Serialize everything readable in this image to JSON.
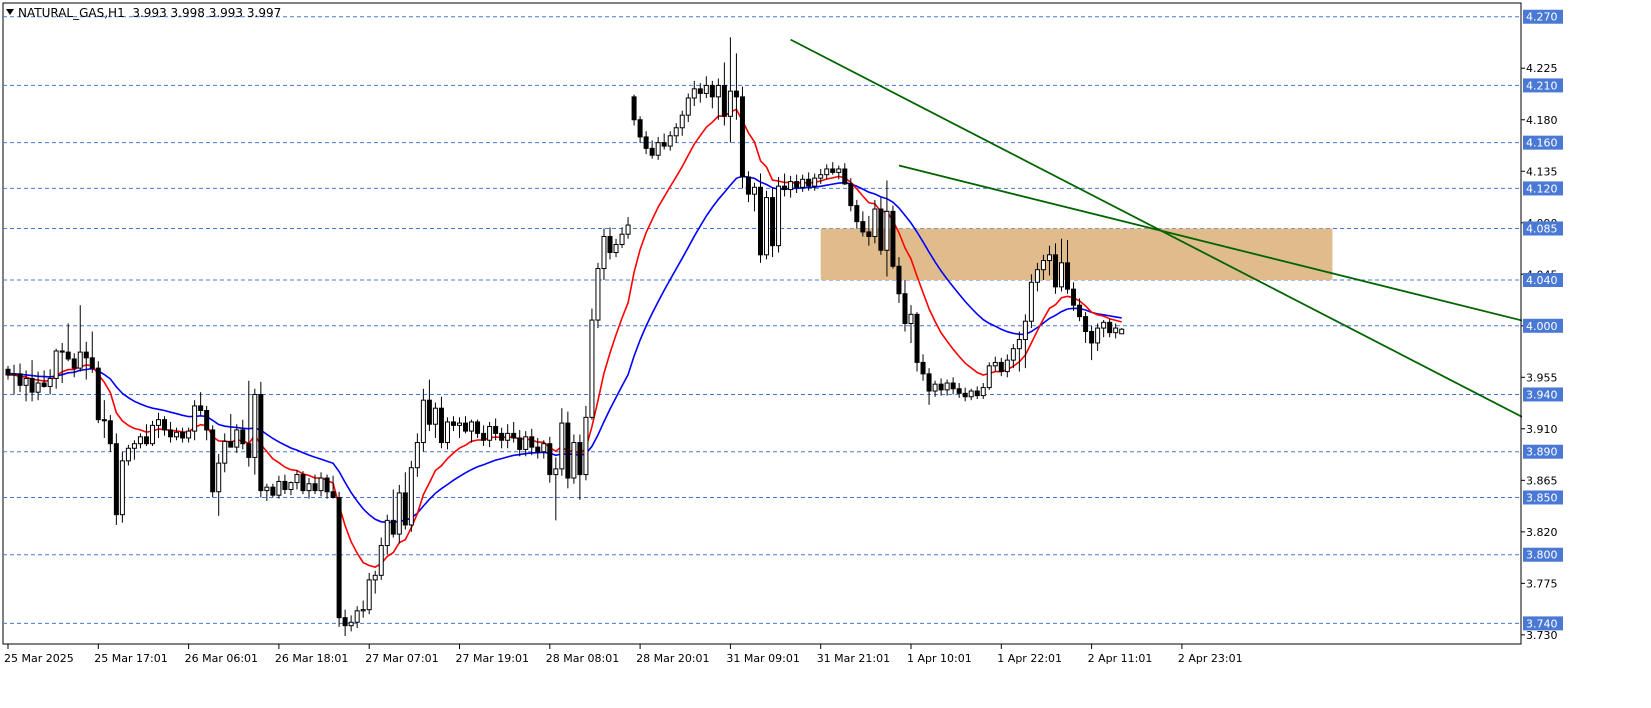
{
  "window": {
    "symbol": "NATURAL_GAS,H1",
    "ohlc": "3.993 3.998 3.993 3.997"
  },
  "chart_data": {
    "type": "candlestick",
    "ylim": [
      3.722,
      4.282
    ],
    "y_ticks": [
      "4.225",
      "4.180",
      "4.135",
      "4.090",
      "4.045",
      "4.000",
      "3.955",
      "3.910",
      "3.865",
      "3.820",
      "3.775",
      "3.730"
    ],
    "level_lines": [
      {
        "value": 4.27,
        "label": "4.270"
      },
      {
        "value": 4.21,
        "label": "4.210"
      },
      {
        "value": 4.16,
        "label": "4.160"
      },
      {
        "value": 4.12,
        "label": "4.120"
      },
      {
        "value": 4.085,
        "label": "4.085"
      },
      {
        "value": 4.04,
        "label": "4.040"
      },
      {
        "value": 4.0,
        "label": "4.000"
      },
      {
        "value": 3.94,
        "label": "3.940"
      },
      {
        "value": 3.89,
        "label": "3.890"
      },
      {
        "value": 3.85,
        "label": "3.850"
      },
      {
        "value": 3.8,
        "label": "3.800"
      },
      {
        "value": 3.74,
        "label": "3.740"
      }
    ],
    "x_labels": [
      "25 Mar 2025",
      "25 Mar 17:01",
      "26 Mar 06:01",
      "26 Mar 18:01",
      "27 Mar 07:01",
      "27 Mar 19:01",
      "28 Mar 08:01",
      "28 Mar 20:01",
      "31 Mar 09:01",
      "31 Mar 21:01",
      "1 Apr 10:01",
      "1 Apr 22:01",
      "2 Apr 11:01",
      "2 Apr 23:01"
    ],
    "resistance_zone": {
      "from_bar": 135,
      "to_bar": 220,
      "low": 4.04,
      "high": 4.085
    },
    "trendlines": [
      {
        "x1": 130.0,
        "y1": 4.25,
        "x2": 253.5,
        "y2": 3.915
      },
      {
        "x1": 148.0,
        "y1": 4.14,
        "x2": 253.5,
        "y2": 4.002
      }
    ],
    "candles": [
      {
        "o": 3.962,
        "h": 3.965,
        "l": 3.953,
        "c": 3.957
      },
      {
        "o": 3.957,
        "h": 3.966,
        "l": 3.94,
        "c": 3.958
      },
      {
        "o": 3.958,
        "h": 3.967,
        "l": 3.942,
        "c": 3.948
      },
      {
        "o": 3.948,
        "h": 3.961,
        "l": 3.934,
        "c": 3.954
      },
      {
        "o": 3.954,
        "h": 3.97,
        "l": 3.934,
        "c": 3.942
      },
      {
        "o": 3.942,
        "h": 3.96,
        "l": 3.935,
        "c": 3.95
      },
      {
        "o": 3.95,
        "h": 3.961,
        "l": 3.946,
        "c": 3.947
      },
      {
        "o": 3.947,
        "h": 3.962,
        "l": 3.94,
        "c": 3.954
      },
      {
        "o": 3.954,
        "h": 3.98,
        "l": 3.945,
        "c": 3.978
      },
      {
        "o": 3.978,
        "h": 3.985,
        "l": 3.95,
        "c": 3.977
      },
      {
        "o": 3.977,
        "h": 4.002,
        "l": 3.969,
        "c": 3.971
      },
      {
        "o": 3.971,
        "h": 3.976,
        "l": 3.955,
        "c": 3.963
      },
      {
        "o": 3.963,
        "h": 4.018,
        "l": 3.96,
        "c": 3.977
      },
      {
        "o": 3.977,
        "h": 3.986,
        "l": 3.953,
        "c": 3.972
      },
      {
        "o": 3.972,
        "h": 3.995,
        "l": 3.959,
        "c": 3.963
      },
      {
        "o": 3.963,
        "h": 3.969,
        "l": 3.915,
        "c": 3.918
      },
      {
        "o": 3.918,
        "h": 3.935,
        "l": 3.902,
        "c": 3.917
      },
      {
        "o": 3.917,
        "h": 3.922,
        "l": 3.89,
        "c": 3.897
      },
      {
        "o": 3.897,
        "h": 3.906,
        "l": 3.826,
        "c": 3.835
      },
      {
        "o": 3.835,
        "h": 3.89,
        "l": 3.828,
        "c": 3.882
      },
      {
        "o": 3.882,
        "h": 3.896,
        "l": 3.878,
        "c": 3.893
      },
      {
        "o": 3.893,
        "h": 3.9,
        "l": 3.883,
        "c": 3.897
      },
      {
        "o": 3.897,
        "h": 3.906,
        "l": 3.893,
        "c": 3.903
      },
      {
        "o": 3.903,
        "h": 3.914,
        "l": 3.895,
        "c": 3.897
      },
      {
        "o": 3.897,
        "h": 3.917,
        "l": 3.895,
        "c": 3.913
      },
      {
        "o": 3.913,
        "h": 3.924,
        "l": 3.902,
        "c": 3.918
      },
      {
        "o": 3.918,
        "h": 3.921,
        "l": 3.904,
        "c": 3.909
      },
      {
        "o": 3.909,
        "h": 3.916,
        "l": 3.898,
        "c": 3.903
      },
      {
        "o": 3.903,
        "h": 3.911,
        "l": 3.9,
        "c": 3.907
      },
      {
        "o": 3.907,
        "h": 3.911,
        "l": 3.898,
        "c": 3.902
      },
      {
        "o": 3.902,
        "h": 3.911,
        "l": 3.898,
        "c": 3.908
      },
      {
        "o": 3.908,
        "h": 3.935,
        "l": 3.9,
        "c": 3.93
      },
      {
        "o": 3.93,
        "h": 3.942,
        "l": 3.922,
        "c": 3.926
      },
      {
        "o": 3.926,
        "h": 3.93,
        "l": 3.9,
        "c": 3.909
      },
      {
        "o": 3.909,
        "h": 3.913,
        "l": 3.85,
        "c": 3.855
      },
      {
        "o": 3.855,
        "h": 3.888,
        "l": 3.834,
        "c": 3.88
      },
      {
        "o": 3.88,
        "h": 3.906,
        "l": 3.872,
        "c": 3.899
      },
      {
        "o": 3.899,
        "h": 3.923,
        "l": 3.895,
        "c": 3.894
      },
      {
        "o": 3.894,
        "h": 3.914,
        "l": 3.889,
        "c": 3.909
      },
      {
        "o": 3.909,
        "h": 3.918,
        "l": 3.892,
        "c": 3.897
      },
      {
        "o": 3.897,
        "h": 3.952,
        "l": 3.877,
        "c": 3.885
      },
      {
        "o": 3.885,
        "h": 3.945,
        "l": 3.87,
        "c": 3.94
      },
      {
        "o": 3.94,
        "h": 3.951,
        "l": 3.85,
        "c": 3.856
      },
      {
        "o": 3.856,
        "h": 3.862,
        "l": 3.847,
        "c": 3.859
      },
      {
        "o": 3.859,
        "h": 3.862,
        "l": 3.85,
        "c": 3.852
      },
      {
        "o": 3.852,
        "h": 3.869,
        "l": 3.849,
        "c": 3.864
      },
      {
        "o": 3.864,
        "h": 3.87,
        "l": 3.853,
        "c": 3.857
      },
      {
        "o": 3.857,
        "h": 3.864,
        "l": 3.852,
        "c": 3.863
      },
      {
        "o": 3.863,
        "h": 3.874,
        "l": 3.857,
        "c": 3.87
      },
      {
        "o": 3.87,
        "h": 3.873,
        "l": 3.853,
        "c": 3.856
      },
      {
        "o": 3.856,
        "h": 3.867,
        "l": 3.849,
        "c": 3.862
      },
      {
        "o": 3.862,
        "h": 3.87,
        "l": 3.853,
        "c": 3.856
      },
      {
        "o": 3.856,
        "h": 3.872,
        "l": 3.851,
        "c": 3.867
      },
      {
        "o": 3.867,
        "h": 3.87,
        "l": 3.849,
        "c": 3.855
      },
      {
        "o": 3.855,
        "h": 3.869,
        "l": 3.849,
        "c": 3.85
      },
      {
        "o": 3.85,
        "h": 3.855,
        "l": 3.737,
        "c": 3.745
      },
      {
        "o": 3.745,
        "h": 3.752,
        "l": 3.729,
        "c": 3.738
      },
      {
        "o": 3.738,
        "h": 3.747,
        "l": 3.733,
        "c": 3.741
      },
      {
        "o": 3.741,
        "h": 3.755,
        "l": 3.736,
        "c": 3.751
      },
      {
        "o": 3.751,
        "h": 3.76,
        "l": 3.745,
        "c": 3.752
      },
      {
        "o": 3.752,
        "h": 3.784,
        "l": 3.748,
        "c": 3.778
      },
      {
        "o": 3.778,
        "h": 3.786,
        "l": 3.766,
        "c": 3.782
      },
      {
        "o": 3.782,
        "h": 3.815,
        "l": 3.778,
        "c": 3.808
      },
      {
        "o": 3.808,
        "h": 3.835,
        "l": 3.8,
        "c": 3.83
      },
      {
        "o": 3.83,
        "h": 3.857,
        "l": 3.815,
        "c": 3.818
      },
      {
        "o": 3.818,
        "h": 3.861,
        "l": 3.81,
        "c": 3.854
      },
      {
        "o": 3.854,
        "h": 3.872,
        "l": 3.822,
        "c": 3.826
      },
      {
        "o": 3.826,
        "h": 3.882,
        "l": 3.82,
        "c": 3.876
      },
      {
        "o": 3.876,
        "h": 3.906,
        "l": 3.868,
        "c": 3.898
      },
      {
        "o": 3.898,
        "h": 3.945,
        "l": 3.89,
        "c": 3.935
      },
      {
        "o": 3.935,
        "h": 3.953,
        "l": 3.908,
        "c": 3.914
      },
      {
        "o": 3.914,
        "h": 3.933,
        "l": 3.902,
        "c": 3.928
      },
      {
        "o": 3.928,
        "h": 3.938,
        "l": 3.893,
        "c": 3.898
      },
      {
        "o": 3.898,
        "h": 3.92,
        "l": 3.892,
        "c": 3.916
      },
      {
        "o": 3.916,
        "h": 3.921,
        "l": 3.908,
        "c": 3.913
      },
      {
        "o": 3.913,
        "h": 3.92,
        "l": 3.902,
        "c": 3.915
      },
      {
        "o": 3.915,
        "h": 3.921,
        "l": 3.906,
        "c": 3.908
      },
      {
        "o": 3.908,
        "h": 3.918,
        "l": 3.898,
        "c": 3.916
      },
      {
        "o": 3.916,
        "h": 3.918,
        "l": 3.902,
        "c": 3.906
      },
      {
        "o": 3.906,
        "h": 3.913,
        "l": 3.895,
        "c": 3.9
      },
      {
        "o": 3.9,
        "h": 3.916,
        "l": 3.894,
        "c": 3.912
      },
      {
        "o": 3.912,
        "h": 3.919,
        "l": 3.9,
        "c": 3.906
      },
      {
        "o": 3.906,
        "h": 3.911,
        "l": 3.893,
        "c": 3.9
      },
      {
        "o": 3.9,
        "h": 3.914,
        "l": 3.893,
        "c": 3.906
      },
      {
        "o": 3.906,
        "h": 3.916,
        "l": 3.898,
        "c": 3.902
      },
      {
        "o": 3.902,
        "h": 3.909,
        "l": 3.886,
        "c": 3.892
      },
      {
        "o": 3.892,
        "h": 3.908,
        "l": 3.886,
        "c": 3.903
      },
      {
        "o": 3.903,
        "h": 3.91,
        "l": 3.887,
        "c": 3.894
      },
      {
        "o": 3.894,
        "h": 3.902,
        "l": 3.884,
        "c": 3.89
      },
      {
        "o": 3.89,
        "h": 3.9,
        "l": 3.884,
        "c": 3.897
      },
      {
        "o": 3.897,
        "h": 3.903,
        "l": 3.863,
        "c": 3.87
      },
      {
        "o": 3.87,
        "h": 3.885,
        "l": 3.83,
        "c": 3.875
      },
      {
        "o": 3.875,
        "h": 3.928,
        "l": 3.869,
        "c": 3.915
      },
      {
        "o": 3.915,
        "h": 3.925,
        "l": 3.858,
        "c": 3.867
      },
      {
        "o": 3.867,
        "h": 3.905,
        "l": 3.862,
        "c": 3.898
      },
      {
        "o": 3.898,
        "h": 3.905,
        "l": 3.848,
        "c": 3.87
      },
      {
        "o": 3.87,
        "h": 3.93,
        "l": 3.865,
        "c": 3.92
      },
      {
        "o": 3.92,
        "h": 4.015,
        "l": 3.918,
        "c": 4.005
      },
      {
        "o": 4.005,
        "h": 4.055,
        "l": 3.998,
        "c": 4.05
      },
      {
        "o": 4.05,
        "h": 4.085,
        "l": 4.04,
        "c": 4.078
      },
      {
        "o": 4.078,
        "h": 4.086,
        "l": 4.058,
        "c": 4.064
      },
      {
        "o": 4.064,
        "h": 4.076,
        "l": 4.06,
        "c": 4.071
      },
      {
        "o": 4.071,
        "h": 4.086,
        "l": 4.068,
        "c": 4.08
      },
      {
        "o": 4.08,
        "h": 4.095,
        "l": 4.076,
        "c": 4.088
      },
      {
        "o": 4.2,
        "h": 4.202,
        "l": 4.175,
        "c": 4.18
      },
      {
        "o": 4.18,
        "h": 4.183,
        "l": 4.16,
        "c": 4.165
      },
      {
        "o": 4.165,
        "h": 4.17,
        "l": 4.15,
        "c": 4.155
      },
      {
        "o": 4.155,
        "h": 4.162,
        "l": 4.146,
        "c": 4.149
      },
      {
        "o": 4.149,
        "h": 4.165,
        "l": 4.145,
        "c": 4.16
      },
      {
        "o": 4.16,
        "h": 4.168,
        "l": 4.154,
        "c": 4.157
      },
      {
        "o": 4.157,
        "h": 4.17,
        "l": 4.153,
        "c": 4.166
      },
      {
        "o": 4.166,
        "h": 4.177,
        "l": 4.16,
        "c": 4.173
      },
      {
        "o": 4.173,
        "h": 4.188,
        "l": 4.166,
        "c": 4.184
      },
      {
        "o": 4.184,
        "h": 4.203,
        "l": 4.178,
        "c": 4.199
      },
      {
        "o": 4.199,
        "h": 4.214,
        "l": 4.192,
        "c": 4.207
      },
      {
        "o": 4.207,
        "h": 4.212,
        "l": 4.195,
        "c": 4.203
      },
      {
        "o": 4.203,
        "h": 4.218,
        "l": 4.199,
        "c": 4.21
      },
      {
        "o": 4.21,
        "h": 4.214,
        "l": 4.19,
        "c": 4.2
      },
      {
        "o": 4.2,
        "h": 4.216,
        "l": 4.18,
        "c": 4.21
      },
      {
        "o": 4.21,
        "h": 4.23,
        "l": 4.175,
        "c": 4.183
      },
      {
        "o": 4.183,
        "h": 4.252,
        "l": 4.16,
        "c": 4.205
      },
      {
        "o": 4.205,
        "h": 4.238,
        "l": 4.18,
        "c": 4.2
      },
      {
        "o": 4.2,
        "h": 4.209,
        "l": 4.12,
        "c": 4.13
      },
      {
        "o": 4.13,
        "h": 4.135,
        "l": 4.108,
        "c": 4.115
      },
      {
        "o": 4.115,
        "h": 4.125,
        "l": 4.1,
        "c": 4.121
      },
      {
        "o": 4.121,
        "h": 4.133,
        "l": 4.055,
        "c": 4.062
      },
      {
        "o": 4.062,
        "h": 4.118,
        "l": 4.058,
        "c": 4.112
      },
      {
        "o": 4.112,
        "h": 4.12,
        "l": 4.06,
        "c": 4.07
      },
      {
        "o": 4.07,
        "h": 4.13,
        "l": 4.064,
        "c": 4.122
      },
      {
        "o": 4.122,
        "h": 4.133,
        "l": 4.113,
        "c": 4.119
      },
      {
        "o": 4.119,
        "h": 4.131,
        "l": 4.112,
        "c": 4.126
      },
      {
        "o": 4.126,
        "h": 4.132,
        "l": 4.116,
        "c": 4.121
      },
      {
        "o": 4.121,
        "h": 4.132,
        "l": 4.117,
        "c": 4.128
      },
      {
        "o": 4.128,
        "h": 4.134,
        "l": 4.118,
        "c": 4.122
      },
      {
        "o": 4.122,
        "h": 4.133,
        "l": 4.118,
        "c": 4.129
      },
      {
        "o": 4.129,
        "h": 4.137,
        "l": 4.124,
        "c": 4.132
      },
      {
        "o": 4.132,
        "h": 4.141,
        "l": 4.128,
        "c": 4.137
      },
      {
        "o": 4.137,
        "h": 4.143,
        "l": 4.132,
        "c": 4.134
      },
      {
        "o": 4.134,
        "h": 4.14,
        "l": 4.128,
        "c": 4.137
      },
      {
        "o": 4.137,
        "h": 4.142,
        "l": 4.123,
        "c": 4.124
      },
      {
        "o": 4.124,
        "h": 4.129,
        "l": 4.1,
        "c": 4.105
      },
      {
        "o": 4.105,
        "h": 4.11,
        "l": 4.085,
        "c": 4.091
      },
      {
        "o": 4.091,
        "h": 4.1,
        "l": 4.078,
        "c": 4.082
      },
      {
        "o": 4.082,
        "h": 4.096,
        "l": 4.07,
        "c": 4.078
      },
      {
        "o": 4.078,
        "h": 4.11,
        "l": 4.072,
        "c": 4.102
      },
      {
        "o": 4.102,
        "h": 4.112,
        "l": 4.062,
        "c": 4.066
      },
      {
        "o": 4.066,
        "h": 4.127,
        "l": 4.043,
        "c": 4.1
      },
      {
        "o": 4.1,
        "h": 4.105,
        "l": 4.05,
        "c": 4.052
      },
      {
        "o": 4.052,
        "h": 4.06,
        "l": 4.02,
        "c": 4.028
      },
      {
        "o": 4.028,
        "h": 4.04,
        "l": 3.995,
        "c": 4.002
      },
      {
        "o": 4.002,
        "h": 4.018,
        "l": 3.985,
        "c": 4.01
      },
      {
        "o": 4.01,
        "h": 4.012,
        "l": 3.96,
        "c": 3.968
      },
      {
        "o": 3.968,
        "h": 3.975,
        "l": 3.952,
        "c": 3.958
      },
      {
        "o": 3.958,
        "h": 3.963,
        "l": 3.931,
        "c": 3.943
      },
      {
        "o": 3.943,
        "h": 3.952,
        "l": 3.938,
        "c": 3.949
      },
      {
        "o": 3.949,
        "h": 3.954,
        "l": 3.939,
        "c": 3.944
      },
      {
        "o": 3.944,
        "h": 3.953,
        "l": 3.939,
        "c": 3.95
      },
      {
        "o": 3.95,
        "h": 3.955,
        "l": 3.94,
        "c": 3.945
      },
      {
        "o": 3.945,
        "h": 3.95,
        "l": 3.937,
        "c": 3.941
      },
      {
        "o": 3.941,
        "h": 3.946,
        "l": 3.934,
        "c": 3.938
      },
      {
        "o": 3.938,
        "h": 3.945,
        "l": 3.935,
        "c": 3.943
      },
      {
        "o": 3.943,
        "h": 3.947,
        "l": 3.936,
        "c": 3.939
      },
      {
        "o": 3.939,
        "h": 3.95,
        "l": 3.936,
        "c": 3.946
      },
      {
        "o": 3.946,
        "h": 3.968,
        "l": 3.944,
        "c": 3.965
      },
      {
        "o": 3.965,
        "h": 3.973,
        "l": 3.96,
        "c": 3.968
      },
      {
        "o": 3.968,
        "h": 3.972,
        "l": 3.956,
        "c": 3.96
      },
      {
        "o": 3.96,
        "h": 3.975,
        "l": 3.955,
        "c": 3.97
      },
      {
        "o": 3.97,
        "h": 3.984,
        "l": 3.963,
        "c": 3.98
      },
      {
        "o": 3.98,
        "h": 3.995,
        "l": 3.96,
        "c": 3.988
      },
      {
        "o": 3.988,
        "h": 4.01,
        "l": 3.963,
        "c": 4.004
      },
      {
        "o": 4.004,
        "h": 4.045,
        "l": 3.998,
        "c": 4.038
      },
      {
        "o": 4.038,
        "h": 4.055,
        "l": 4.03,
        "c": 4.049
      },
      {
        "o": 4.049,
        "h": 4.062,
        "l": 4.04,
        "c": 4.057
      },
      {
        "o": 4.057,
        "h": 4.07,
        "l": 4.044,
        "c": 4.062
      },
      {
        "o": 4.062,
        "h": 4.072,
        "l": 4.028,
        "c": 4.034
      },
      {
        "o": 4.034,
        "h": 4.076,
        "l": 4.03,
        "c": 4.055
      },
      {
        "o": 4.055,
        "h": 4.075,
        "l": 4.028,
        "c": 4.032
      },
      {
        "o": 4.032,
        "h": 4.038,
        "l": 4.013,
        "c": 4.018
      },
      {
        "o": 4.018,
        "h": 4.024,
        "l": 4.004,
        "c": 4.008
      },
      {
        "o": 4.008,
        "h": 4.012,
        "l": 3.985,
        "c": 3.995
      },
      {
        "o": 3.995,
        "h": 4.0,
        "l": 3.97,
        "c": 3.985
      },
      {
        "o": 3.985,
        "h": 4.002,
        "l": 3.978,
        "c": 3.998
      },
      {
        "o": 3.998,
        "h": 4.005,
        "l": 3.99,
        "c": 4.003
      },
      {
        "o": 4.003,
        "h": 4.006,
        "l": 3.99,
        "c": 3.994
      },
      {
        "o": 3.994,
        "h": 4.002,
        "l": 3.989,
        "c": 3.998
      },
      {
        "o": 3.993,
        "h": 3.998,
        "l": 3.993,
        "c": 3.997
      }
    ],
    "ma_fast_color": "#ff0000",
    "ma_slow_color": "#0000ff",
    "trendline_color": "#006400",
    "zone_color": "#deb887",
    "grid_line_color": "#4a79d5"
  }
}
